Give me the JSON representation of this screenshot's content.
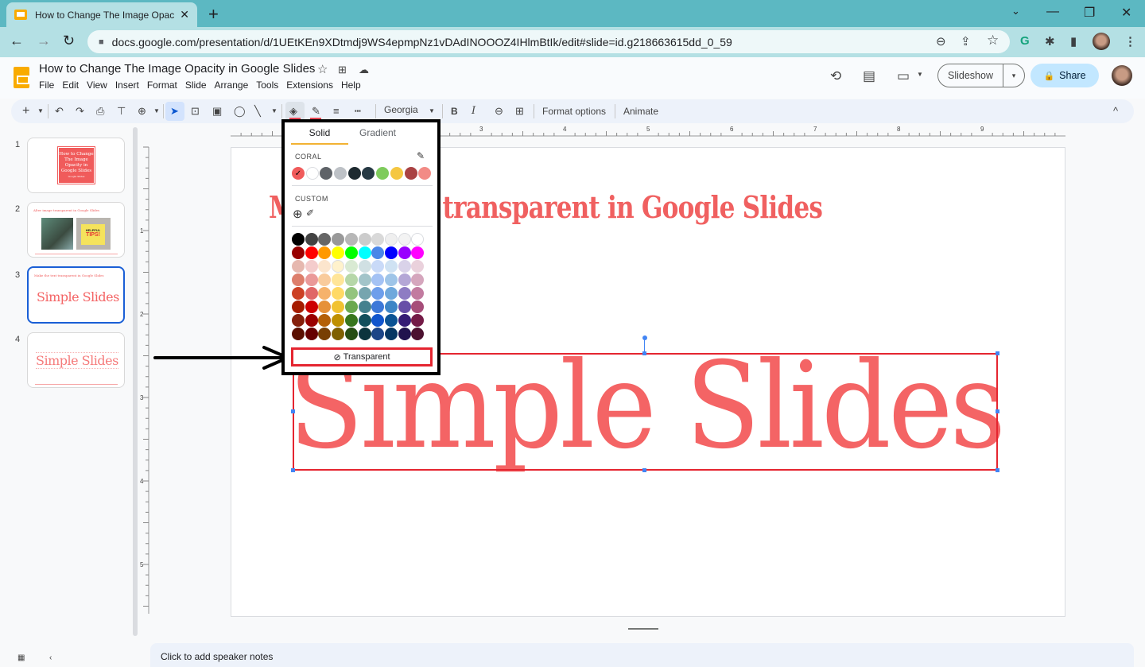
{
  "browser": {
    "tab_title": "How to Change The Image Opaci",
    "tab_close": "✕",
    "new_tab": "+",
    "url": "docs.google.com/presentation/d/1UEtKEn9XDtmdj9WS4epmpNz1vDAdINOOOZ4IHlmBtIk/edit#slide=id.g218663615dd_0_59",
    "window_controls": {
      "tabsearch": "⌄",
      "minimize": "—",
      "restore": "❐",
      "close": "✕"
    },
    "nav": {
      "back": "←",
      "forward": "→",
      "reload": "↻"
    },
    "omnibox_icons": {
      "zoom": "⊖",
      "share": "⇪",
      "bookmark": "☆"
    },
    "extensions": {
      "grammarly": "G",
      "puzzle": "✱",
      "sidepanel": "▮",
      "menu": "⋮"
    }
  },
  "docs": {
    "title": "How to Change The Image Opacity in Google Slides",
    "title_icons": {
      "star": "☆",
      "move": "⊞",
      "cloud": "☁"
    },
    "menu": [
      "File",
      "Edit",
      "View",
      "Insert",
      "Format",
      "Slide",
      "Arrange",
      "Tools",
      "Extensions",
      "Help"
    ],
    "header_icons": {
      "history": "⟲",
      "comments": "▤",
      "meet": "▭"
    },
    "slideshow_label": "Slideshow",
    "slideshow_dropdown": "▾",
    "share_label": "Share",
    "share_icon": "🔒"
  },
  "toolbar": {
    "new_slide": "+",
    "undo": "↶",
    "redo": "↷",
    "print": "⎙",
    "paint_format": "⊤",
    "zoom": "⊕",
    "select": "➤",
    "textbox": "⊡",
    "image": "▣",
    "shape": "◯",
    "line": "╲",
    "fill_color": "◈",
    "border_color": "✎",
    "border_weight": "≡",
    "border_dash": "┅",
    "font": "Georgia",
    "bold": "B",
    "italic": "I",
    "link": "⊖",
    "comment": "⊞",
    "format_options": "Format options",
    "animate": "Animate",
    "collapse": "^"
  },
  "filmstrip": {
    "slides": [
      {
        "number": "1",
        "thumb_lines": [
          "How to Change",
          "The Image",
          "Opacity in",
          "Google Slides"
        ],
        "thumb_sub": "Google Slides"
      },
      {
        "number": "2",
        "thumb_title": "Alter image transparent in Google Slides",
        "thumb_tips": "HELPFUL",
        "thumb_tips2": "TIPS!"
      },
      {
        "number": "3",
        "thumb_title": "Make the text transparent in Google Slides",
        "thumb_text": "Simple Slides",
        "selected": true
      },
      {
        "number": "4",
        "thumb_text": "Simple Slides"
      }
    ]
  },
  "rulers": {
    "horizontal": [
      "3",
      "4",
      "5",
      "6",
      "7",
      "8",
      "9"
    ],
    "vertical": [
      "1",
      "2",
      "3",
      "4",
      "5"
    ]
  },
  "slide": {
    "heading_visible": "M",
    "heading_rest": "xt transparent in Google Slides",
    "textbox_text": "Simple Slides"
  },
  "color_popup": {
    "tab_solid": "Solid",
    "tab_gradient": "Gradient",
    "theme_label": "CORAL",
    "edit_icon": "✎",
    "theme_colors": [
      "#f05b5b",
      "#ffffff",
      "#5f6368",
      "#bdc1c6",
      "#1e2a30",
      "#263944",
      "#7ecb5c",
      "#f5c742",
      "#a94243",
      "#f28b86"
    ],
    "selected_check": "✓",
    "custom_label": "CUSTOM",
    "custom_add": "⊕",
    "custom_eyedropper": "✐",
    "palette": [
      [
        "#000000",
        "#434343",
        "#666666",
        "#999999",
        "#b7b7b7",
        "#cccccc",
        "#d9d9d9",
        "#efefef",
        "#f3f3f3",
        "#ffffff"
      ],
      [
        "#980000",
        "#ff0000",
        "#ff9900",
        "#ffff00",
        "#00ff00",
        "#00ffff",
        "#4a86e8",
        "#0000ff",
        "#9900ff",
        "#ff00ff"
      ],
      [
        "#e6b8af",
        "#f4cccc",
        "#fce5cd",
        "#fff2cc",
        "#d9ead3",
        "#d0e0e3",
        "#c9daf8",
        "#cfe2f3",
        "#d9d2e9",
        "#ead1dc"
      ],
      [
        "#dd7e6b",
        "#ea9999",
        "#f9cb9c",
        "#ffe599",
        "#b6d7a8",
        "#a2c4c9",
        "#a4c2f4",
        "#9fc5e8",
        "#b4a7d6",
        "#d5a6bd"
      ],
      [
        "#cc4125",
        "#e06666",
        "#f6b26b",
        "#ffd966",
        "#93c47d",
        "#76a5af",
        "#6d9eeb",
        "#6fa8dc",
        "#8e7cc3",
        "#c27ba0"
      ],
      [
        "#a61c00",
        "#cc0000",
        "#e69138",
        "#f1c232",
        "#6aa84f",
        "#45818e",
        "#3c78d8",
        "#3d85c6",
        "#674ea7",
        "#a64d79"
      ],
      [
        "#85200c",
        "#990000",
        "#b45f06",
        "#bf9000",
        "#38761d",
        "#134f5c",
        "#1155cc",
        "#0b5394",
        "#351c75",
        "#741b47"
      ],
      [
        "#5b0f00",
        "#660000",
        "#783f04",
        "#7f6000",
        "#274e13",
        "#0c343d",
        "#1c4587",
        "#073763",
        "#20124d",
        "#4c1130"
      ]
    ],
    "transparent_label": "Transparent",
    "transparent_icon": "⊘"
  },
  "annotation": {
    "arrow_head": "➤"
  },
  "notes": {
    "placeholder": "Click to add speaker notes"
  },
  "colors": {
    "accent_red": "#e52530",
    "slide_text": "#f46465",
    "selection_blue": "#1a5fd6",
    "share_bg": "#c2e7ff"
  }
}
